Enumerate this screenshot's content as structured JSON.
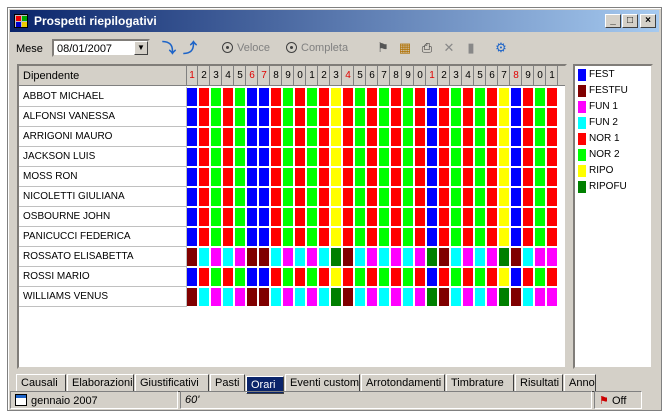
{
  "window": {
    "title": "Prospetti riepilogativi",
    "minimize": "_",
    "maximize": "□",
    "close": "×"
  },
  "toolbar": {
    "mese_label": "Mese",
    "date_value": "08/01/2007",
    "radio_veloce": "Veloce",
    "radio_completa": "Completa"
  },
  "grid": {
    "name_header": "Dipendente",
    "days": [
      "1",
      "2",
      "3",
      "4",
      "5",
      "6",
      "7",
      "8",
      "9",
      "0",
      "1",
      "2",
      "3",
      "4",
      "5",
      "6",
      "7",
      "8",
      "9",
      "0",
      "1",
      "2",
      "3",
      "4",
      "5",
      "6",
      "7",
      "8",
      "9",
      "0",
      "1"
    ],
    "red_days": [
      1,
      6,
      7,
      14,
      21,
      28
    ],
    "employees": [
      "ABBOT MICHAEL",
      "ALFONSI VANESSA",
      "ARRIGONI MAURO",
      "JACKSON LUIS",
      "MOSS RON",
      "NICOLETTI GIULIANA",
      "OSBOURNE JOHN",
      "PANICUCCI FEDERICA",
      "ROSSATO ELISABETTA",
      "ROSSI MARIO",
      "WILLIAMS VENUS"
    ],
    "patterns": {
      "standard": [
        "FEST",
        "NOR 1",
        "NOR 2",
        "NOR 1",
        "NOR 2",
        "FEST",
        "FEST",
        "NOR 1",
        "NOR 2",
        "NOR 1",
        "NOR 2",
        "NOR 1",
        "RIPO",
        "NOR 1",
        "NOR 2",
        "NOR 1",
        "NOR 2",
        "NOR 1",
        "NOR 2",
        "NOR 1",
        "FEST",
        "NOR 1",
        "NOR 2",
        "NOR 1",
        "NOR 2",
        "NOR 1",
        "RIPO",
        "FEST",
        "NOR 1",
        "NOR 2",
        "NOR 1"
      ],
      "alt": [
        "FESTFU",
        "FUN 2",
        "FUN 1",
        "FUN 2",
        "FUN 1",
        "FESTFU",
        "FESTFU",
        "FUN 2",
        "FUN 1",
        "FUN 2",
        "FUN 1",
        "FUN 2",
        "RIPOFU",
        "FESTFU",
        "FUN 2",
        "FUN 1",
        "FUN 2",
        "FUN 1",
        "FUN 2",
        "FUN 1",
        "RIPOFU",
        "FESTFU",
        "FUN 2",
        "FUN 1",
        "FUN 2",
        "FUN 1",
        "RIPOFU",
        "FESTFU",
        "FUN 2",
        "FUN 1",
        "FUN 1"
      ]
    },
    "row_patterns": [
      "standard",
      "standard",
      "standard",
      "standard",
      "standard",
      "standard",
      "standard",
      "standard",
      "alt",
      "standard",
      "alt"
    ]
  },
  "legend": [
    {
      "label": "FEST",
      "color": "#0000ff"
    },
    {
      "label": "FESTFU",
      "color": "#800000"
    },
    {
      "label": "FUN 1",
      "color": "#ff00ff"
    },
    {
      "label": "FUN 2",
      "color": "#00ffff"
    },
    {
      "label": "NOR 1",
      "color": "#ff0000"
    },
    {
      "label": "NOR 2",
      "color": "#00ff00"
    },
    {
      "label": "RIPO",
      "color": "#ffff00"
    },
    {
      "label": "RIPOFU",
      "color": "#008000"
    }
  ],
  "tabs": [
    {
      "label": "Causali",
      "active": false
    },
    {
      "label": "Elaborazioni",
      "active": false
    },
    {
      "label": "Giustificativi",
      "active": false
    },
    {
      "label": "Pasti",
      "active": false
    },
    {
      "label": "Orari",
      "active": true
    },
    {
      "label": "Eventi custom",
      "active": false
    },
    {
      "label": "Arrotondamenti",
      "active": false
    },
    {
      "label": "Timbrature",
      "active": false
    },
    {
      "label": "Risultati",
      "active": false
    },
    {
      "label": "Anno",
      "active": false
    }
  ],
  "status": {
    "month": "gennaio 2007",
    "mid": "60'",
    "toggle": "Off"
  }
}
